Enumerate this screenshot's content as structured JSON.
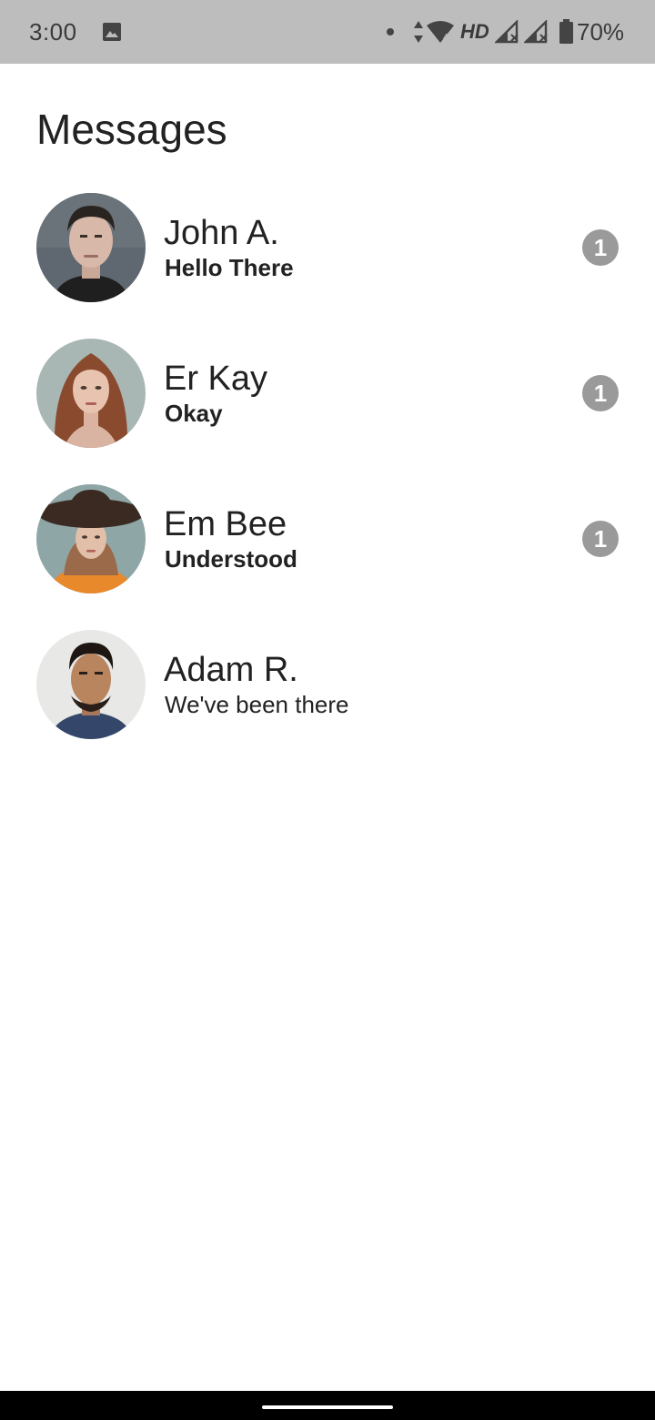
{
  "status_bar": {
    "time": "3:00",
    "network_label": "HD",
    "battery": "70%",
    "icons": [
      "gallery-icon",
      "notification-dot-icon",
      "data-arrows-icon",
      "wifi-icon",
      "signal-icon",
      "signal-icon",
      "battery-icon"
    ]
  },
  "header": {
    "title": "Messages"
  },
  "conversations": [
    {
      "name": "John A.",
      "preview": "Hello There",
      "unread_count": "1",
      "unread": true
    },
    {
      "name": "Er Kay",
      "preview": "Okay",
      "unread_count": "1",
      "unread": true
    },
    {
      "name": "Em Bee",
      "preview": "Understood",
      "unread_count": "1",
      "unread": true
    },
    {
      "name": "Adam R.",
      "preview": "We've been there",
      "unread_count": "",
      "unread": false
    }
  ],
  "colors": {
    "status_bar_bg": "#bdbdbd",
    "badge_bg": "#9a9a9a",
    "nav_bar_bg": "#000000"
  }
}
